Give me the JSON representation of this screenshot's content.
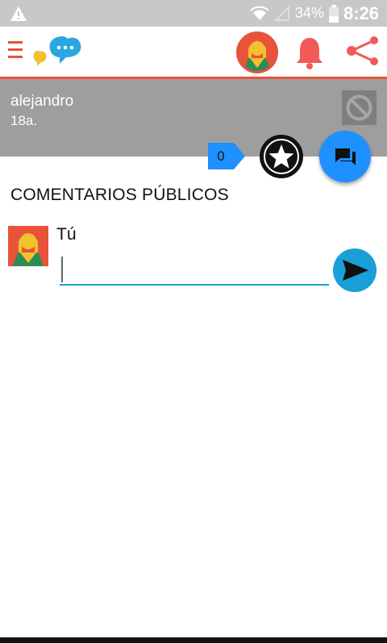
{
  "status_bar": {
    "battery_percent": "34%",
    "time": "8:26"
  },
  "app_bar": {
    "colors": {
      "accent": "#e8533a",
      "logo_blue": "#2aa6e0",
      "logo_yellow": "#f2c12e"
    }
  },
  "profile": {
    "name": "alejandro",
    "age": "18a."
  },
  "actions": {
    "counter": "0"
  },
  "comments": {
    "section_title": "COMENTARIOS PÚBLICOS",
    "current_user_label": "Tú",
    "input_value": "",
    "input_placeholder": ""
  }
}
